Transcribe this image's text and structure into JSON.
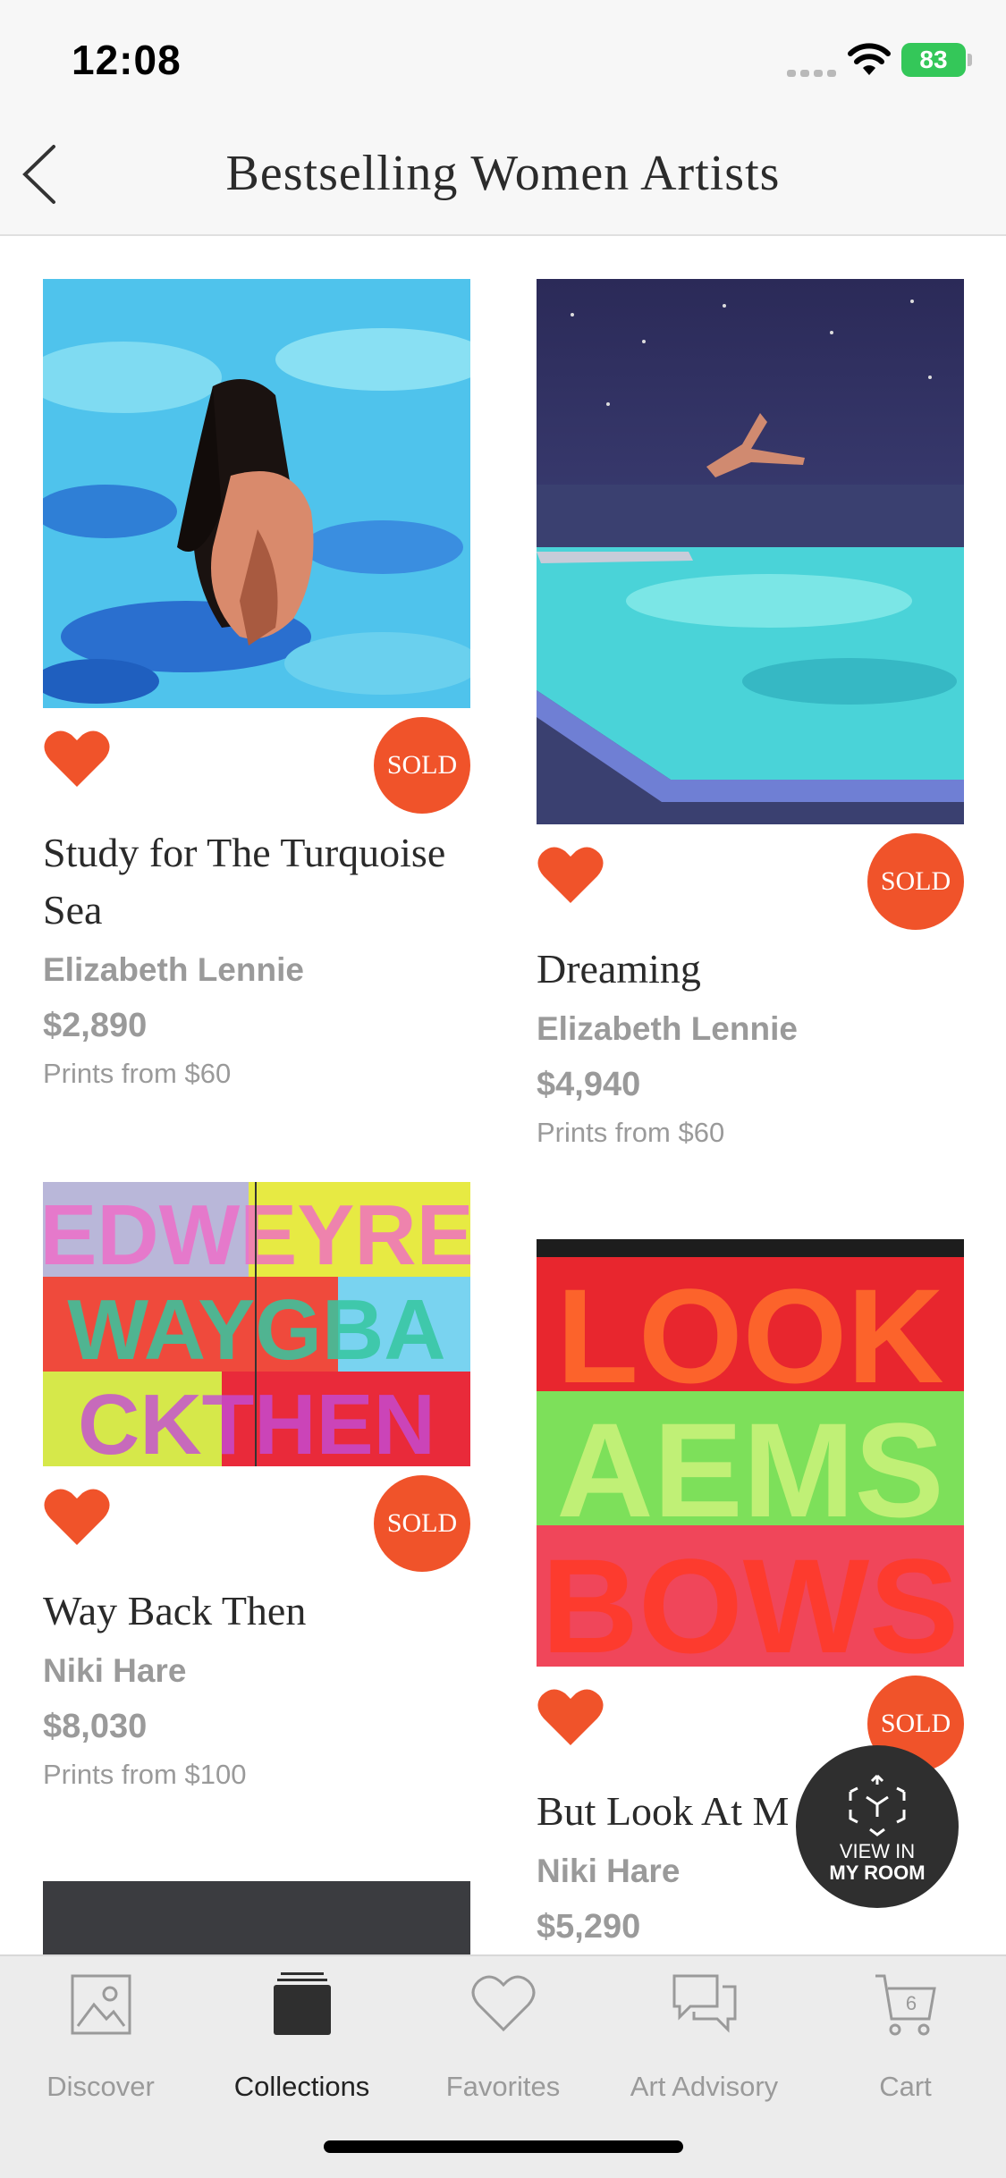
{
  "status": {
    "time": "12:08",
    "battery": "83"
  },
  "header": {
    "title": "Bestselling Women Artists"
  },
  "artworks": [
    {
      "title": "Study for The Turquoise Sea",
      "artist": "Elizabeth Lennie",
      "price": "$2,890",
      "prints": "Prints from $60",
      "badge": "SOLD"
    },
    {
      "title": "Dreaming",
      "artist": "Elizabeth Lennie",
      "price": "$4,940",
      "prints": "Prints from $60",
      "badge": "SOLD"
    },
    {
      "title": "Way Back Then",
      "artist": "Niki Hare",
      "price": "$8,030",
      "prints": "Prints from $100",
      "badge": "SOLD"
    },
    {
      "title": "But Look At M",
      "artist": "Niki Hare",
      "price": "$5,290",
      "badge": "SOLD"
    }
  ],
  "art_text": {
    "wbt": [
      "EDWEYRE",
      "WAYGBA",
      "CKTHEN"
    ],
    "look": [
      "LOOK",
      "AEMS",
      "BOWS"
    ]
  },
  "view_room": {
    "line1": "VIEW IN",
    "line2": "MY ROOM"
  },
  "tabs": [
    {
      "label": "Discover",
      "icon": "photo-icon"
    },
    {
      "label": "Collections",
      "icon": "collections-icon"
    },
    {
      "label": "Favorites",
      "icon": "heart-icon"
    },
    {
      "label": "Art Advisory",
      "icon": "chat-icon"
    },
    {
      "label": "Cart",
      "icon": "cart-icon",
      "count": "6"
    }
  ],
  "colors": {
    "accent": "#f0532a",
    "sold": "#f0532a",
    "heart": "#f0532a",
    "battery": "#34c759"
  }
}
